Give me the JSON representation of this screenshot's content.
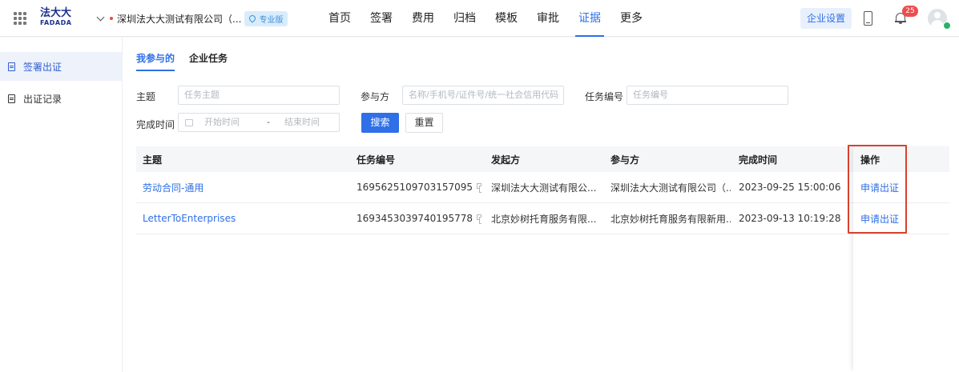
{
  "header": {
    "logo_cn": "法大大",
    "logo_en": "FADADA",
    "company_name": "深圳法大大测试有限公司（...",
    "edition_badge": "专业版",
    "nav": [
      "首页",
      "签署",
      "费用",
      "归档",
      "模板",
      "审批",
      "证据",
      "更多"
    ],
    "active_nav": "证据",
    "enterprise_settings": "企业设置",
    "notification_count": "25"
  },
  "sidebar": {
    "items": [
      "签署出证",
      "出证记录"
    ],
    "active": "签署出证"
  },
  "tabs": [
    "我参与的",
    "企业任务"
  ],
  "filters": {
    "subject_label": "主题",
    "subject_placeholder": "任务主题",
    "party_label": "参与方",
    "party_placeholder": "名称/手机号/证件号/统一社会信用代码",
    "task_no_label": "任务编号",
    "task_no_placeholder": "任务编号",
    "finish_time_label": "完成时间",
    "start_placeholder": "开始时间",
    "range_sep": "-",
    "end_placeholder": "结束时间",
    "search_button": "搜索",
    "reset_button": "重置"
  },
  "table": {
    "columns": [
      "主题",
      "任务编号",
      "发起方",
      "参与方",
      "完成时间",
      "操作"
    ],
    "rows": [
      {
        "subject": "劳动合同-通用",
        "task_no": "1695625109703157095",
        "initiator": "深圳法大大测试有限公...",
        "party": "深圳法大大测试有限公司（...",
        "finish_time": "2023-09-25 15:00:06",
        "action": "申请出证"
      },
      {
        "subject": "LetterToEnterprises",
        "task_no": "1693453039740195778",
        "initiator": "北京妙树托育服务有限...",
        "party": "北京妙树托育服务有限新用...",
        "finish_time": "2023-09-13 10:19:28",
        "action": "申请出证"
      }
    ]
  },
  "colors": {
    "primary": "#2f6fe8",
    "highlight_border": "#d9402c",
    "badge_red": "#ef4d4d"
  }
}
